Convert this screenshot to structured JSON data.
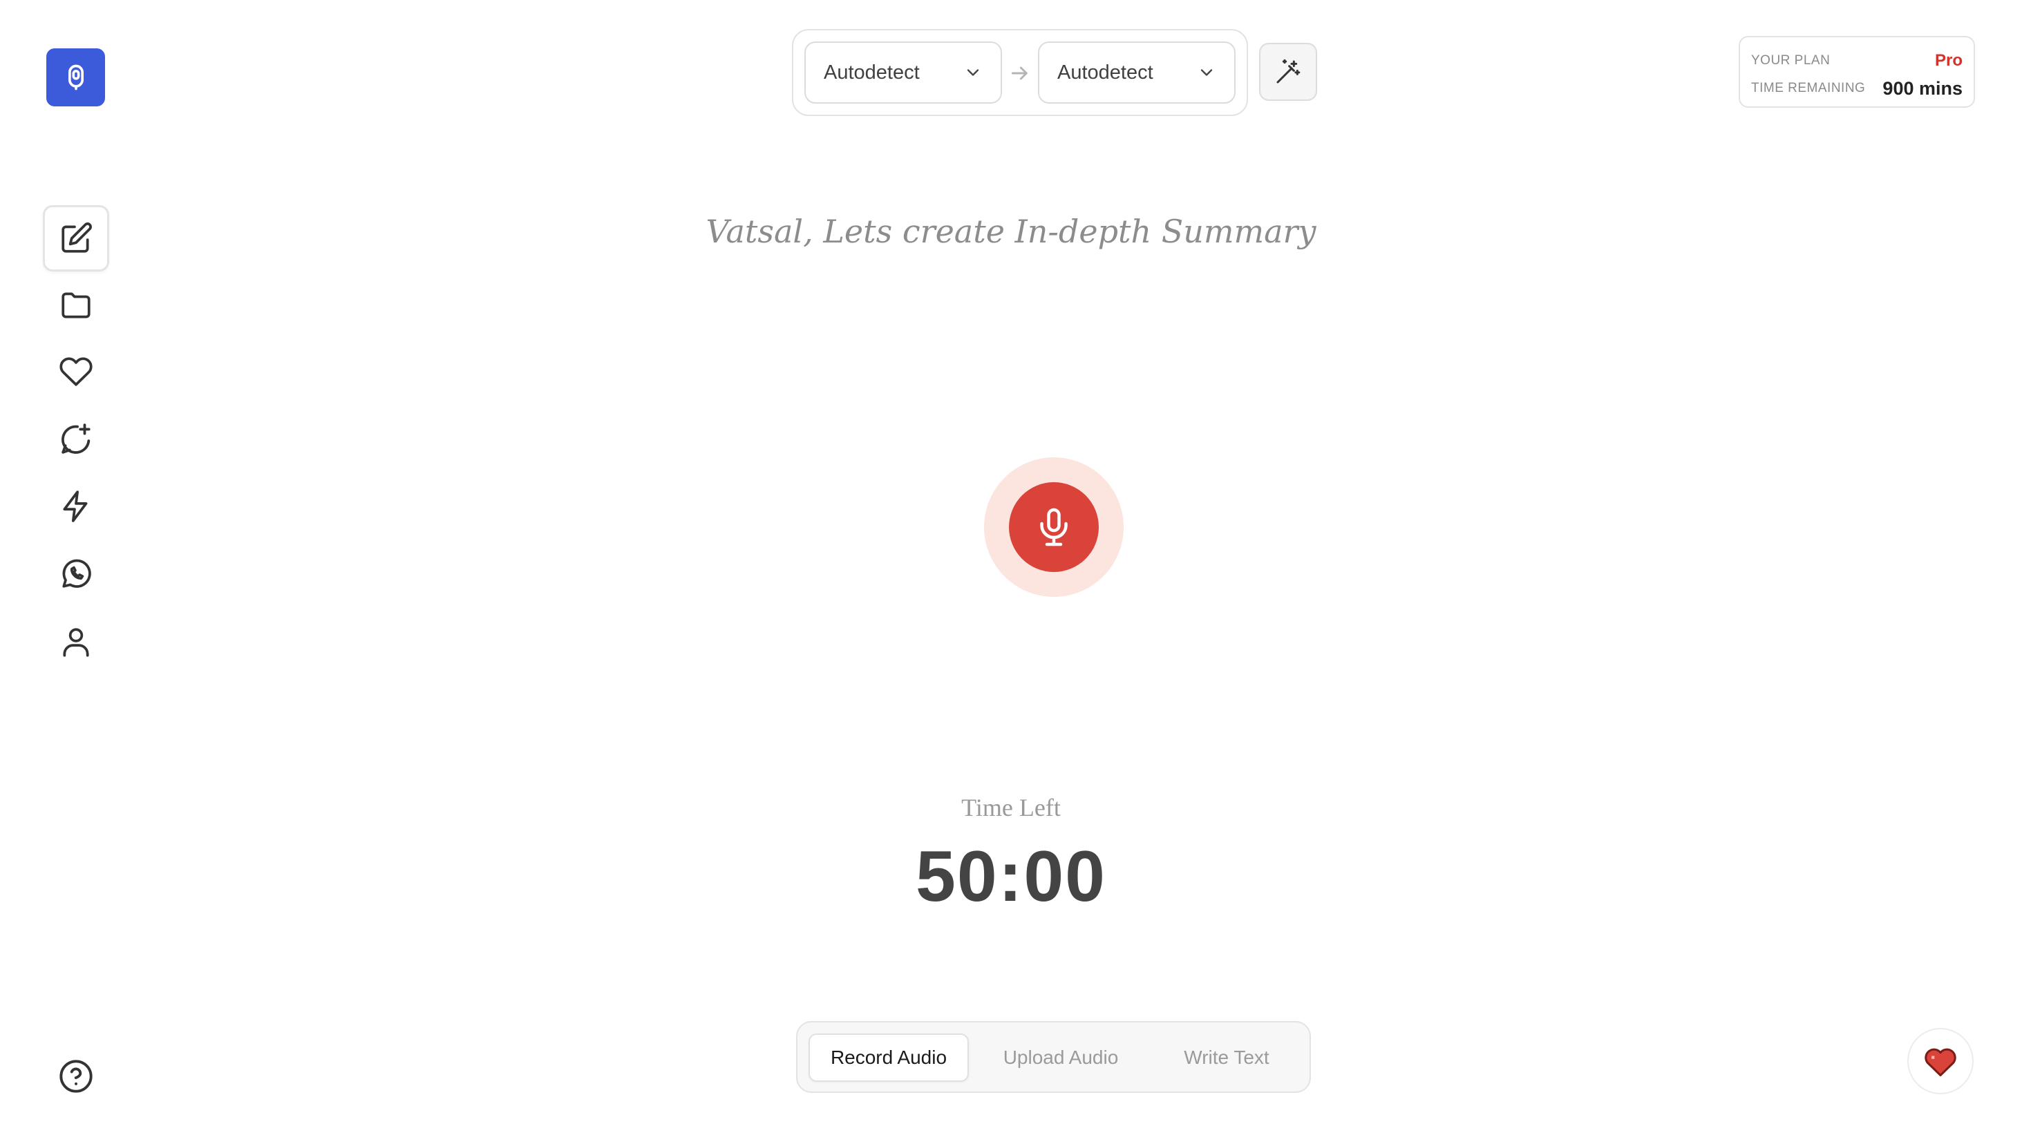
{
  "colors": {
    "brand": "#3b5bdb",
    "record": "#d9433a",
    "record_halo": "#fde5df",
    "plan_accent": "#d0342c"
  },
  "sidebar": {
    "logo_icon": "microphone-badge-icon",
    "items": [
      {
        "id": "new-note",
        "icon": "edit-note-icon",
        "active": true
      },
      {
        "id": "folders",
        "icon": "folder-icon",
        "active": false
      },
      {
        "id": "favorites",
        "icon": "heart-icon",
        "active": false
      },
      {
        "id": "ai-chat",
        "icon": "chat-sparkle-icon",
        "active": false
      },
      {
        "id": "quick-actions",
        "icon": "lightning-icon",
        "active": false
      },
      {
        "id": "whatsapp",
        "icon": "whatsapp-icon",
        "active": false
      },
      {
        "id": "profile",
        "icon": "user-icon",
        "active": false
      }
    ],
    "help_icon": "help-circle-icon"
  },
  "language": {
    "source": "Autodetect",
    "target": "Autodetect"
  },
  "plan": {
    "plan_label": "YOUR PLAN",
    "plan_name": "Pro",
    "time_label": "TIME REMAINING",
    "time_value": "900 mins"
  },
  "main": {
    "greeting": "Vatsal, Lets create In-depth Summary",
    "time_left_label": "Time Left",
    "timer": "50:00"
  },
  "modes": [
    {
      "label": "Record Audio",
      "active": true
    },
    {
      "label": "Upload Audio",
      "active": false
    },
    {
      "label": "Write Text",
      "active": false
    }
  ]
}
